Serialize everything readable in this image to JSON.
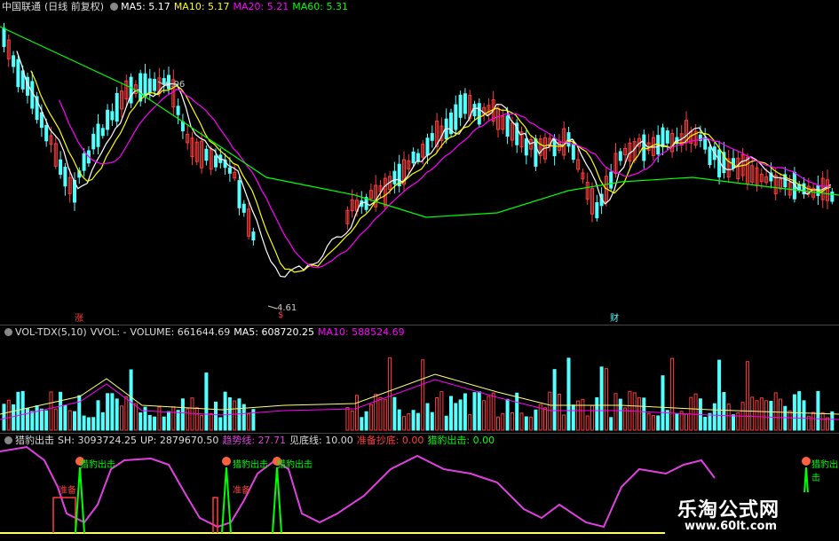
{
  "main_header": {
    "stock": "中国联通",
    "period": "(日线 前复权)",
    "ma5": "MA5: 5.17",
    "ma10": "MA10: 5.17",
    "ma20": "MA20: 5.21",
    "ma60": "MA60: 5.31"
  },
  "price_marks": {
    "high": "6.06",
    "low": "4.61"
  },
  "event_tags": {
    "t1": "涨",
    "t2": "$",
    "t3": "财"
  },
  "vol_header": {
    "name": "VOL-TDX(5,10)",
    "vvol": "VVOL: -",
    "volume": "VOLUME: 661644.69",
    "ma5": "MA5: 608720.25",
    "ma10": "MA10: 588524.69"
  },
  "ind_header": {
    "name": "猎豹出击",
    "sh": "SH: 3093724.25",
    "up": "UP: 2879670.50",
    "trend": "趋势线: 27.71",
    "bottom": "见底线: 10.00",
    "ready": "准备抄底: 0.00",
    "strike": "猎豹出击: 0.00"
  },
  "signals": {
    "strike": "猎豹出击",
    "ready": "准备"
  },
  "watermark": {
    "title": "乐淘公式网",
    "url": "www.60lt.com"
  },
  "colors": {
    "up": "#ff3c3c",
    "down": "#54ffff",
    "ma5": "#ffffff",
    "ma10": "#ffff00",
    "ma20": "#ff00ff",
    "ma60": "#00ff00",
    "trend": "#e040e0",
    "signal": "#00ff00"
  }
}
